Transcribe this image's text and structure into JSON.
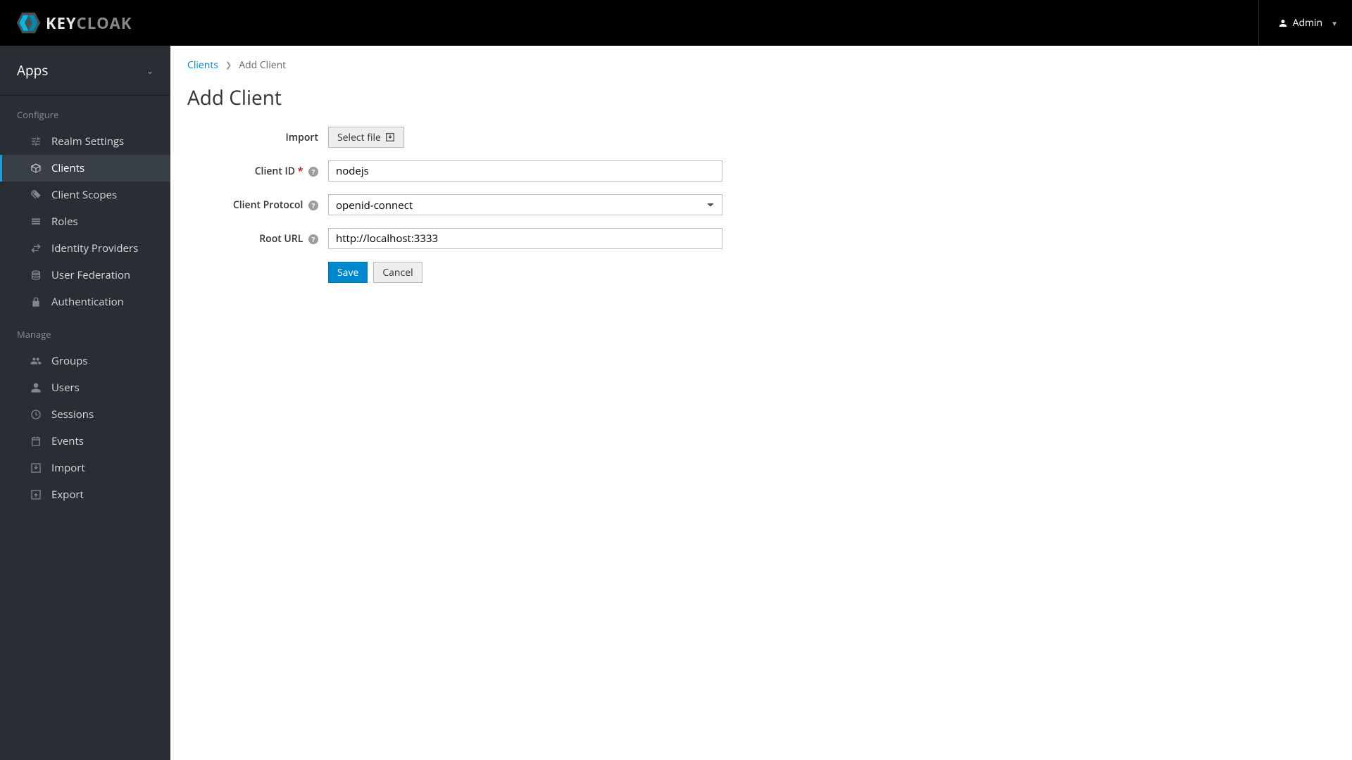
{
  "header": {
    "brand_key": "KEY",
    "brand_cloak": "CLOAK",
    "user_label": "Admin"
  },
  "sidebar": {
    "realm": "Apps",
    "section_configure": "Configure",
    "section_manage": "Manage",
    "items_configure": [
      {
        "label": "Realm Settings",
        "id": "realm-settings"
      },
      {
        "label": "Clients",
        "id": "clients",
        "active": true
      },
      {
        "label": "Client Scopes",
        "id": "client-scopes"
      },
      {
        "label": "Roles",
        "id": "roles"
      },
      {
        "label": "Identity Providers",
        "id": "identity-providers"
      },
      {
        "label": "User Federation",
        "id": "user-federation"
      },
      {
        "label": "Authentication",
        "id": "authentication"
      }
    ],
    "items_manage": [
      {
        "label": "Groups",
        "id": "groups"
      },
      {
        "label": "Users",
        "id": "users"
      },
      {
        "label": "Sessions",
        "id": "sessions"
      },
      {
        "label": "Events",
        "id": "events"
      },
      {
        "label": "Import",
        "id": "import"
      },
      {
        "label": "Export",
        "id": "export"
      }
    ]
  },
  "breadcrumb": {
    "parent": "Clients",
    "current": "Add Client"
  },
  "page": {
    "title": "Add Client"
  },
  "form": {
    "import_label": "Import",
    "select_file_label": "Select file",
    "client_id_label": "Client ID",
    "client_id_value": "nodejs",
    "client_protocol_label": "Client Protocol",
    "client_protocol_value": "openid-connect",
    "root_url_label": "Root URL",
    "root_url_value": "http://localhost:3333",
    "save_label": "Save",
    "cancel_label": "Cancel"
  }
}
